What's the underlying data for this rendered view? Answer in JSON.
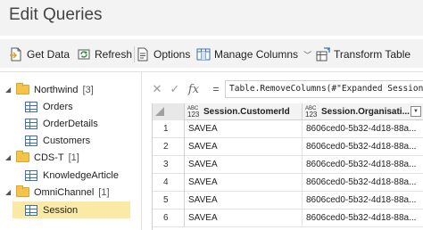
{
  "window": {
    "title": "Edit Queries"
  },
  "toolbar": {
    "get_data": {
      "label": "Get Data",
      "icon": "get-data-icon"
    },
    "refresh": {
      "label": "Refresh",
      "icon": "refresh-icon"
    },
    "options": {
      "label": "Options",
      "icon": "options-icon"
    },
    "manage_columns": {
      "label": "Manage Columns",
      "icon": "manage-columns-icon"
    },
    "transform_table": {
      "label": "Transform Table",
      "icon": "transform-table-icon"
    }
  },
  "navigator": {
    "groups": [
      {
        "label": "Northwind",
        "count": "[3]",
        "items": [
          "Orders",
          "OrderDetails",
          "Customers"
        ]
      },
      {
        "label": "CDS-T",
        "count": "[1]",
        "items": [
          "KnowledgeArticle"
        ]
      },
      {
        "label": "OmniChannel",
        "count": "[1]",
        "items": [
          "Session"
        ]
      }
    ],
    "selected": "Session"
  },
  "formula_bar": {
    "cancel": "✕",
    "commit": "✓",
    "fx": "fx",
    "equals": "=",
    "text": "Table.RemoveColumns(#\"Expanded Session"
  },
  "grid": {
    "type_badge": {
      "top": "ABC",
      "bottom": "123"
    },
    "columns": [
      "Session.CustomerId",
      "Session.Organisati..."
    ],
    "rows": [
      {
        "num": "1",
        "cells": [
          "SAVEA",
          "8606ced0-5b32-4d18-88a..."
        ]
      },
      {
        "num": "2",
        "cells": [
          "SAVEA",
          "8606ced0-5b32-4d18-88a..."
        ]
      },
      {
        "num": "3",
        "cells": [
          "SAVEA",
          "8606ced0-5b32-4d18-88a..."
        ]
      },
      {
        "num": "4",
        "cells": [
          "SAVEA",
          "8606ced0-5b32-4d18-88a..."
        ]
      },
      {
        "num": "5",
        "cells": [
          "SAVEA",
          "8606ced0-5b32-4d18-88a..."
        ]
      },
      {
        "num": "6",
        "cells": [
          "SAVEA",
          "8606ced0-5b32-4d18-88a..."
        ]
      }
    ]
  },
  "colors": {
    "selected_bg": "#fbe9a6",
    "folder": "#f5c34a",
    "accent_blue": "#3b6fb6"
  }
}
